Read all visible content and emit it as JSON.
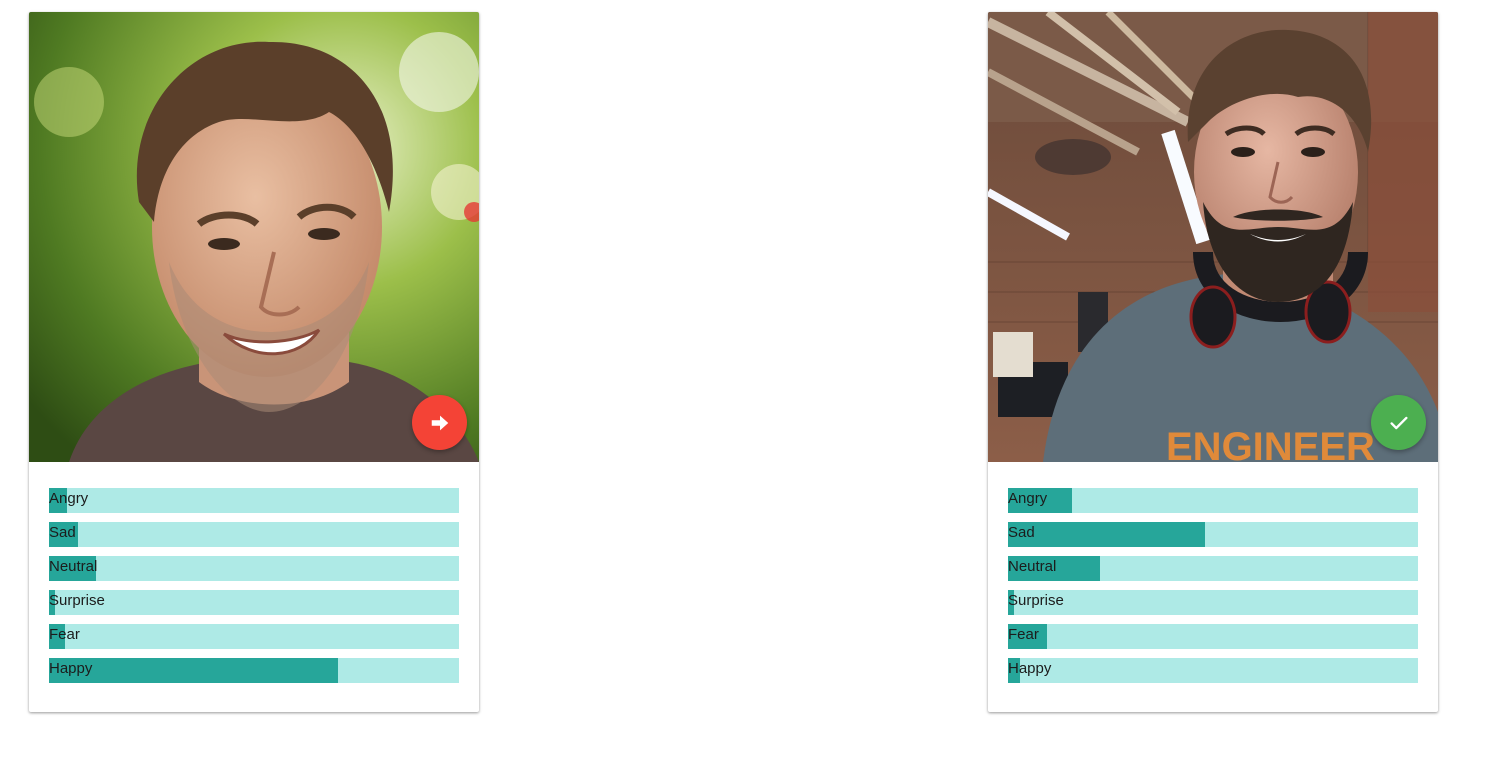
{
  "colors": {
    "track": "#aeeae6",
    "fill": "#26a69a",
    "next_button": "#f44336",
    "check_button": "#4caf50"
  },
  "cards": [
    {
      "image": "portrait of smiling man outdoors",
      "action": {
        "icon": "arrow-right-icon",
        "color": "#f44336"
      },
      "emotions": [
        {
          "label": "Angry",
          "value": 0.045
        },
        {
          "label": "Sad",
          "value": 0.07
        },
        {
          "label": "Neutral",
          "value": 0.115
        },
        {
          "label": "Surprise",
          "value": 0.015
        },
        {
          "label": "Fear",
          "value": 0.04
        },
        {
          "label": "Happy",
          "value": 0.705
        }
      ]
    },
    {
      "image": "webcam photo of bearded man with headphones in office",
      "action": {
        "icon": "check-icon",
        "color": "#4caf50"
      },
      "emotions": [
        {
          "label": "Angry",
          "value": 0.155
        },
        {
          "label": "Sad",
          "value": 0.48
        },
        {
          "label": "Neutral",
          "value": 0.225
        },
        {
          "label": "Surprise",
          "value": 0.015
        },
        {
          "label": "Fear",
          "value": 0.095
        },
        {
          "label": "Happy",
          "value": 0.03
        }
      ]
    }
  ]
}
